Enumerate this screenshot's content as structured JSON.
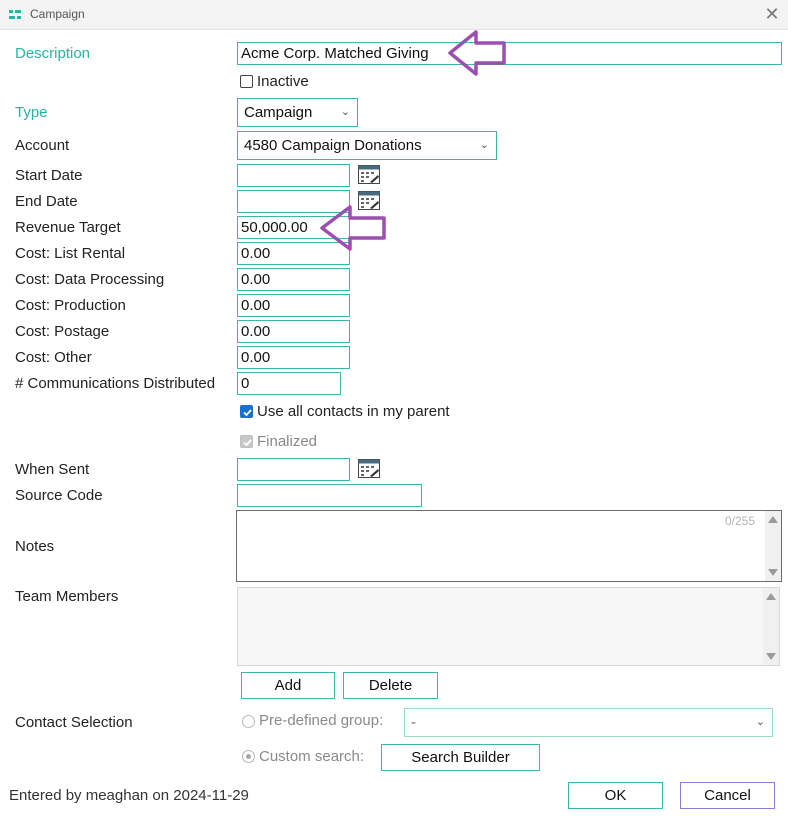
{
  "window": {
    "title": "Campaign",
    "icon": "campaign-app-icon",
    "close_icon": "close-icon",
    "close_glyph": "✕"
  },
  "form": {
    "description": {
      "label": "Description",
      "value": "Acme Corp. Matched Giving"
    },
    "inactive": {
      "label": "Inactive",
      "checked": false
    },
    "type": {
      "label": "Type",
      "value": "Campaign"
    },
    "account": {
      "label": "Account",
      "value": "4580 Campaign Donations"
    },
    "start_date": {
      "label": "Start Date",
      "value": ""
    },
    "end_date": {
      "label": "End Date",
      "value": ""
    },
    "revenue_target": {
      "label": "Revenue Target",
      "value": "50,000.00"
    },
    "cost_list_rental": {
      "label": "Cost: List Rental",
      "value": "0.00"
    },
    "cost_data_processing": {
      "label": "Cost: Data Processing",
      "value": "0.00"
    },
    "cost_production": {
      "label": "Cost: Production",
      "value": "0.00"
    },
    "cost_postage": {
      "label": "Cost: Postage",
      "value": "0.00"
    },
    "cost_other": {
      "label": "Cost: Other",
      "value": "0.00"
    },
    "communications_distributed": {
      "label": "# Communications Distributed",
      "value": "0"
    },
    "use_all_contacts": {
      "label": "Use all contacts in my parent",
      "checked": true
    },
    "finalized": {
      "label": "Finalized",
      "checked": true,
      "disabled": true
    },
    "when_sent": {
      "label": "When Sent",
      "value": ""
    },
    "source_code": {
      "label": "Source Code",
      "value": ""
    },
    "notes": {
      "label": "Notes",
      "value": "",
      "counter": "0/255"
    },
    "team_members": {
      "label": "Team Members",
      "add_label": "Add",
      "delete_label": "Delete"
    },
    "contact_selection": {
      "label": "Contact Selection",
      "predefined_label": "Pre-defined group:",
      "predefined_value": "-",
      "custom_label": "Custom search:",
      "custom_selected": true,
      "search_builder_label": "Search Builder"
    }
  },
  "footer": {
    "entered_by": "Entered by meaghan on 2024-11-29",
    "ok_label": "OK",
    "cancel_label": "Cancel"
  },
  "colors": {
    "accent": "#3fb8a3",
    "label_accent": "#27b5a2",
    "annotation_arrow": "#9b4fb0",
    "cancel_border": "#8a7bd8"
  }
}
